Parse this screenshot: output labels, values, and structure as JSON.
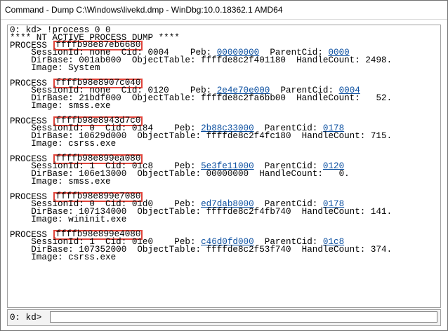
{
  "window": {
    "title": "Command - Dump C:\\Windows\\livekd.dmp - WinDbg:10.0.18362.1 AMD64"
  },
  "output": {
    "command_line": "0: kd> !process 0 0",
    "header": "**** NT ACTIVE PROCESS DUMP ****",
    "process_prefix": "PROCESS ",
    "processes": [
      {
        "address": "ffffb98e87eb6680",
        "line1_a": "    SessionId: none  Cid: 0004    Peb: ",
        "peb": "00000000",
        "line1_b": "  ParentCid: ",
        "parent_cid": "0000",
        "line2": "    DirBase: 001ab000  ObjectTable: ffffde8c2f401180  HandleCount: 2498.",
        "line3": "    Image: System"
      },
      {
        "address": "ffffb98e8907c040",
        "line1_a": "    SessionId: none  Cid: 0120    Peb: ",
        "peb": "2e4e70e000",
        "line1_b": "  ParentCid: ",
        "parent_cid": "0004",
        "line2": "    DirBase: 21bdf000  ObjectTable: ffffde8c2fa6bb00  HandleCount:   52.",
        "line3": "    Image: smss.exe"
      },
      {
        "address": "ffffb98e8943d7c0",
        "line1_a": "    SessionId: 0  Cid: 0184    Peb: ",
        "peb": "2b88c33000",
        "line1_b": "  ParentCid: ",
        "parent_cid": "0178",
        "line2": "    DirBase: 10629d000  ObjectTable: ffffde8c2f4fc180  HandleCount: 715.",
        "line3": "    Image: csrss.exe"
      },
      {
        "address": "ffffb98e899ea080",
        "line1_a": "    SessionId: 1  Cid: 01c8    Peb: ",
        "peb": "5e3fe11000",
        "line1_b": "  ParentCid: ",
        "parent_cid": "0120",
        "line2": "    DirBase: 106e13000  ObjectTable: 00000000  HandleCount:   0.",
        "line3": "    Image: smss.exe"
      },
      {
        "address": "ffffb98e899e7080",
        "line1_a": "    SessionId: 0  Cid: 01d0    Peb: ",
        "peb": "ed7dab8000",
        "line1_b": "  ParentCid: ",
        "parent_cid": "0178",
        "line2": "    DirBase: 107134000  ObjectTable: ffffde8c2f4fb740  HandleCount: 141.",
        "line3": "    Image: wininit.exe"
      },
      {
        "address": "ffffb98e899e4080",
        "line1_a": "    SessionId: 1  Cid: 01e0    Peb: ",
        "peb": "c46d0fd000",
        "line1_b": "  ParentCid: ",
        "parent_cid": "01c8",
        "line2": "    DirBase: 107352000  ObjectTable: ffffde8c2f53f740  HandleCount: 374.",
        "line3": "    Image: csrss.exe"
      }
    ]
  },
  "command_bar": {
    "prompt": "0: kd>",
    "input_value": ""
  },
  "colors": {
    "link": "#0b4fa0",
    "highlight_box": "#e0443a"
  }
}
